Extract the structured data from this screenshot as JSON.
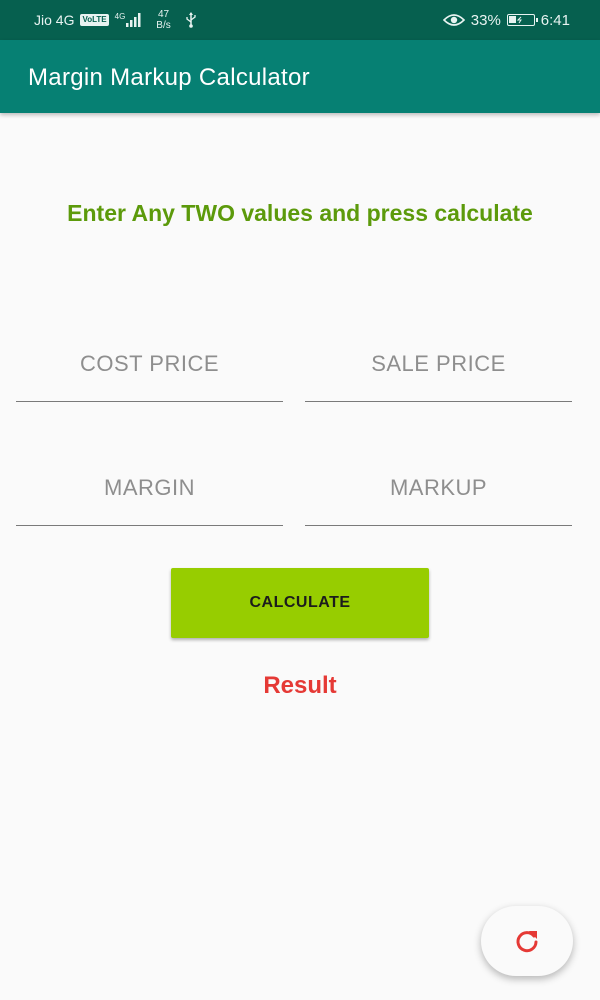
{
  "status_bar": {
    "carrier": "Jio 4G",
    "volte": "VoLTE",
    "network_type": "4G",
    "net_speed_value": "47",
    "net_speed_unit": "B/s",
    "battery_percent": "33%",
    "time": "6:41"
  },
  "app_bar": {
    "title": "Margin Markup Calculator",
    "color": "#068073"
  },
  "main": {
    "instruction": "Enter Any TWO values and press calculate",
    "instruction_color": "#5c9a0b",
    "fields": {
      "cost_price": {
        "placeholder": "COST PRICE",
        "value": ""
      },
      "sale_price": {
        "placeholder": "SALE PRICE",
        "value": ""
      },
      "margin": {
        "placeholder": "MARGIN",
        "value": ""
      },
      "markup": {
        "placeholder": "MARKUP",
        "value": ""
      }
    },
    "calculate_label": "CALCULATE",
    "calculate_color": "#97cd00",
    "result_label": "Result",
    "result_color": "#e53935"
  },
  "fab": {
    "icon": "refresh-icon",
    "icon_color": "#e53935"
  }
}
